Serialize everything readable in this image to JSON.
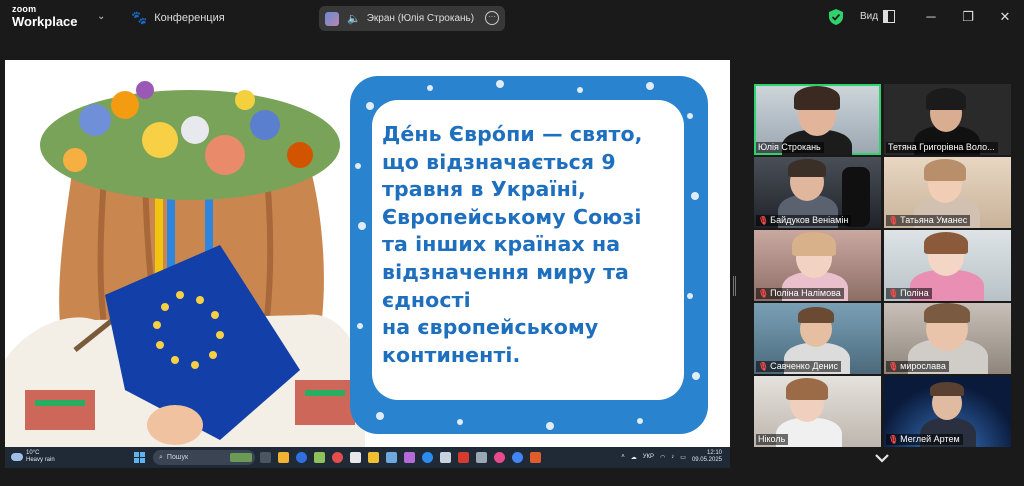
{
  "titlebar": {
    "brand_top": "zoom",
    "brand_bottom": "Workplace",
    "meeting_label": "Конференция",
    "share_label": "Экран (Юлія Строкань)",
    "view_label": "Вид"
  },
  "slide": {
    "text": "Де́нь Євро́пи — свято,\nщо відзначається 9\nтравня в Україні,\nЄвропейському Союзі\nта інших країнах на\nвідзначення миру та\nєдності\nна європейському\nконтиненті."
  },
  "taskbar": {
    "weather_temp": "10°C",
    "weather_desc": "Heavy rain",
    "search_placeholder": "Пошук",
    "lang": "УКР",
    "time": "12:10",
    "date": "09.05.2025"
  },
  "participants": [
    {
      "name": "Юлія Строкань",
      "muted": false,
      "active": true
    },
    {
      "name": "Тетяна Григорівна Воло...",
      "muted": false,
      "active": false
    },
    {
      "name": "Байдуков Веніамін",
      "muted": true,
      "active": false
    },
    {
      "name": "Татьяна Уманес",
      "muted": true,
      "active": false
    },
    {
      "name": "Поліна Налімова",
      "muted": true,
      "active": false
    },
    {
      "name": "Поліна",
      "muted": true,
      "active": false
    },
    {
      "name": "Савченко Денис",
      "muted": true,
      "active": false
    },
    {
      "name": "мирослава",
      "muted": true,
      "active": false
    },
    {
      "name": "Ніколь",
      "muted": false,
      "active": false
    },
    {
      "name": "Меглей Артем",
      "muted": true,
      "active": false
    }
  ],
  "colors": {
    "accent_green": "#2fd36b",
    "slide_blue": "#2a83cf",
    "slide_text": "#1f6fbf",
    "muted_red": "#ff4b4b"
  },
  "icons": [
    "paw-icon",
    "speaker-icon",
    "more-icon",
    "shield-icon",
    "gallery-view-icon",
    "minimize-icon",
    "maximize-icon",
    "close-icon",
    "chevron-down-icon",
    "mic-off-icon"
  ]
}
